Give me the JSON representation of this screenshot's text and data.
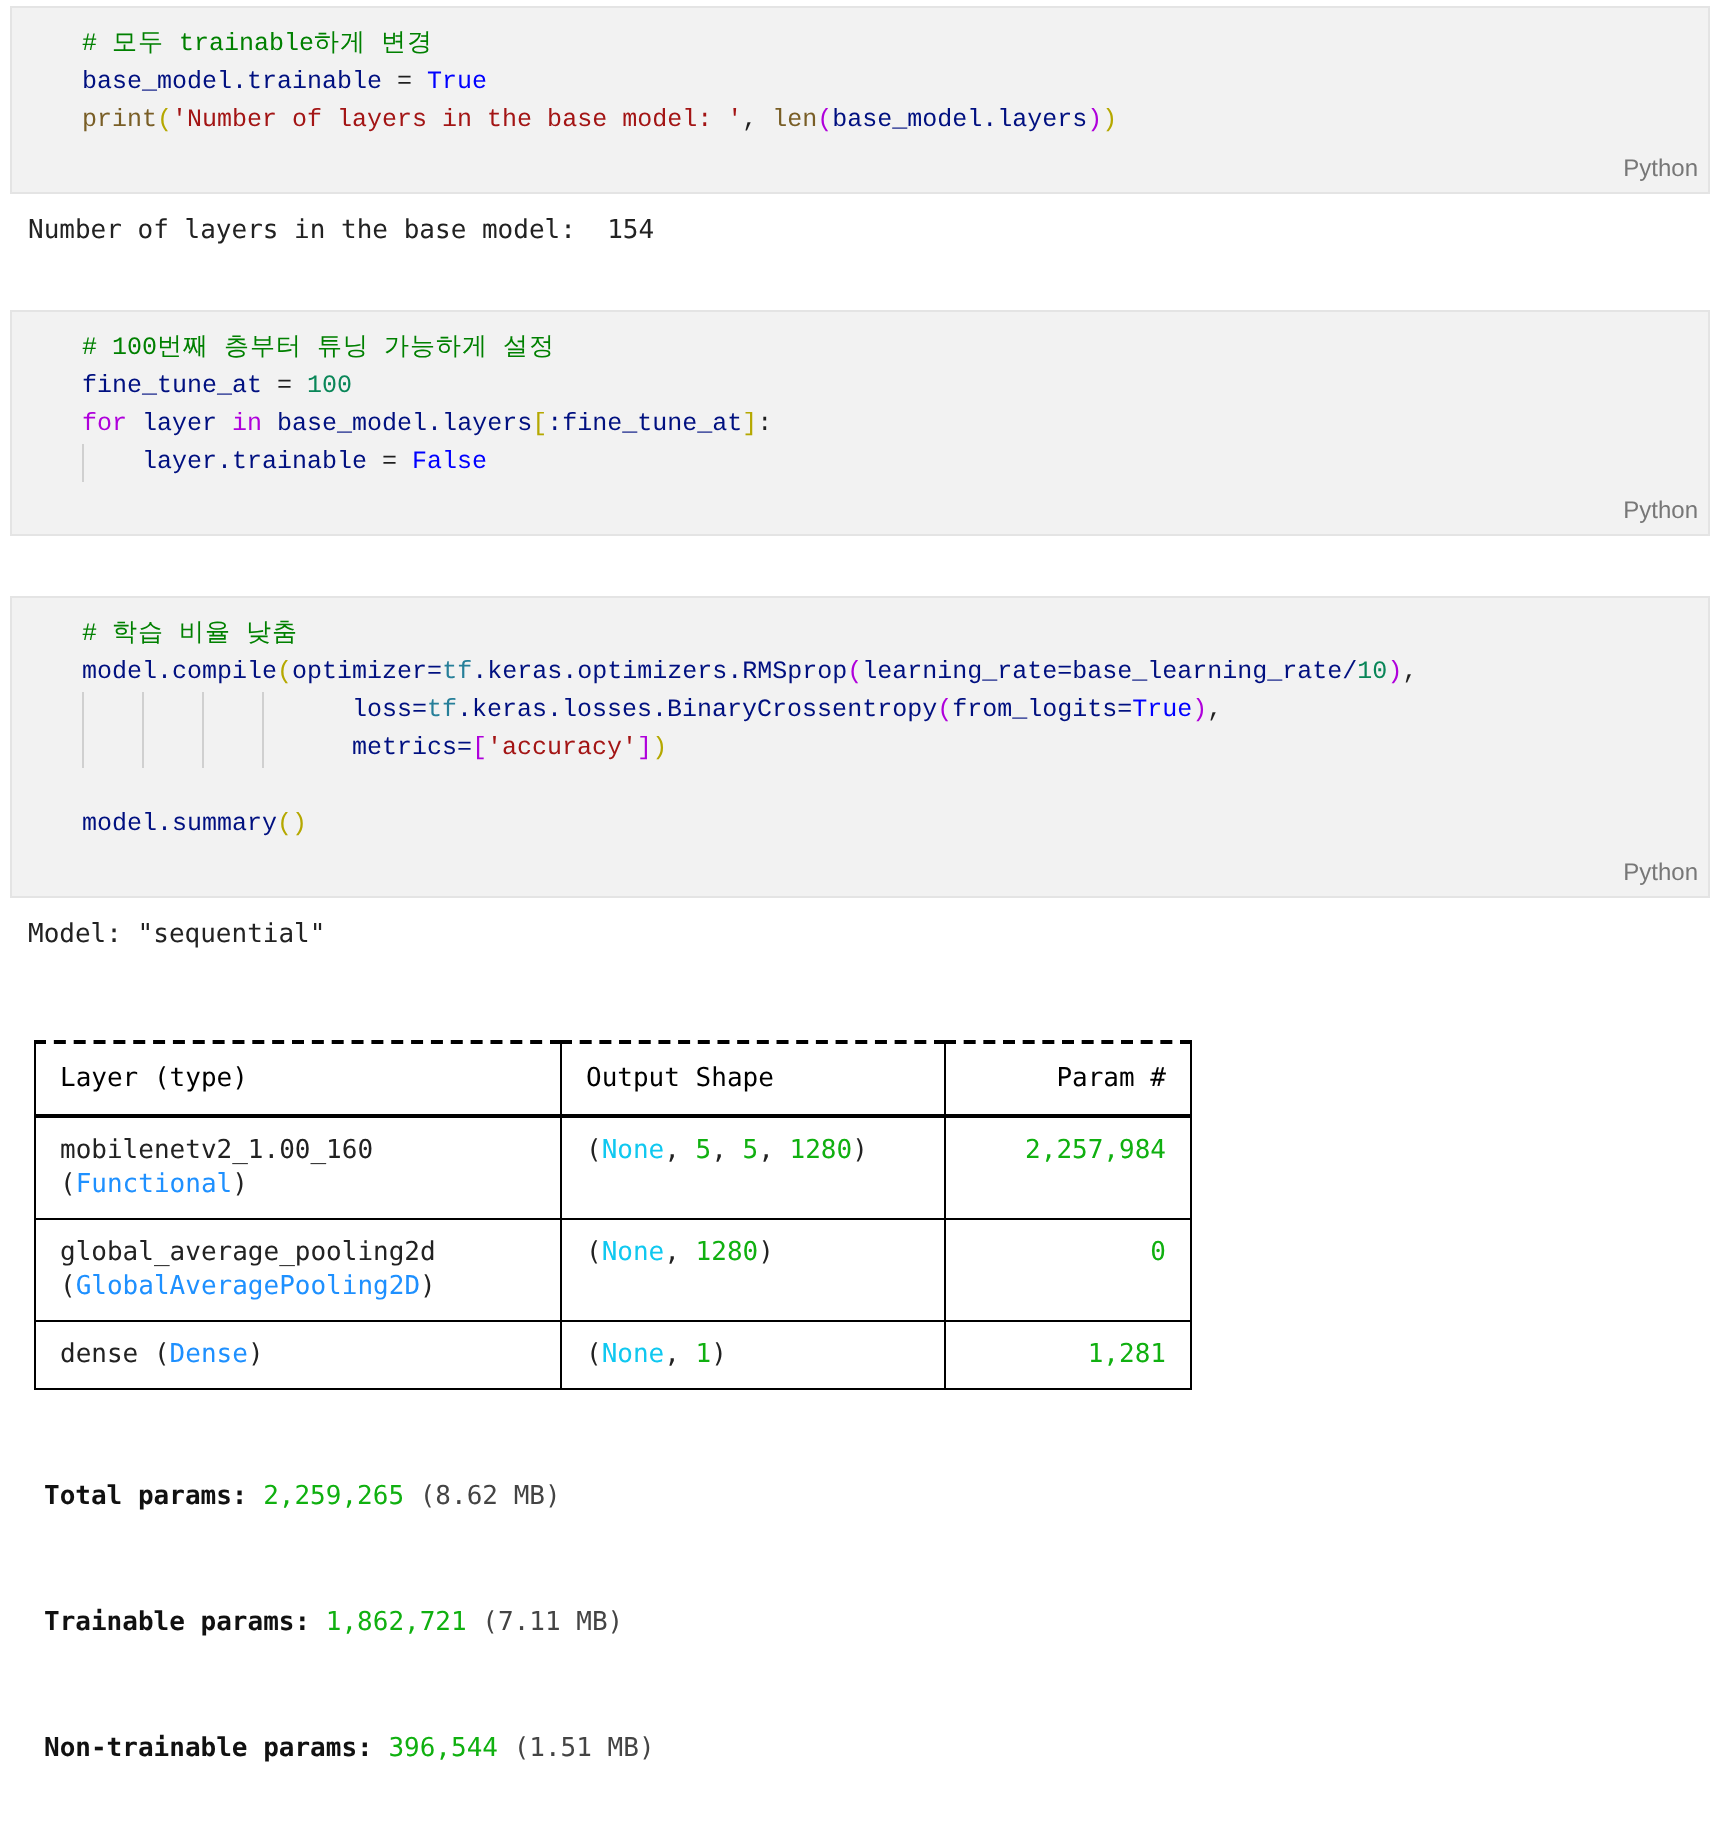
{
  "cells": [
    {
      "language": "Python",
      "lines": [
        {
          "kind": "plain",
          "tokens": [
            {
              "kind": "comment",
              "text": "# 모두 trainable하게 변경"
            }
          ]
        },
        {
          "kind": "plain",
          "tokens": [
            {
              "kind": "var",
              "text": "base_model.trainable"
            },
            {
              "kind": "plain",
              "text": " = "
            },
            {
              "kind": "const",
              "text": "True"
            }
          ]
        },
        {
          "kind": "plain",
          "tokens": [
            {
              "kind": "func",
              "text": "print"
            },
            {
              "kind": "bracket1",
              "text": "("
            },
            {
              "kind": "string",
              "text": "'Number of layers in the base model: '"
            },
            {
              "kind": "plain",
              "text": ", "
            },
            {
              "kind": "func",
              "text": "len"
            },
            {
              "kind": "bracket2",
              "text": "("
            },
            {
              "kind": "var",
              "text": "base_model.layers"
            },
            {
              "kind": "bracket2",
              "text": ")"
            },
            {
              "kind": "bracket1",
              "text": ")"
            }
          ]
        }
      ],
      "output": [
        {
          "kind": "text",
          "lines": [
            [
              {
                "kind": "plain",
                "text": "Number of layers in the base model:  154"
              }
            ]
          ]
        }
      ]
    },
    {
      "language": "Python",
      "lines": [
        {
          "kind": "plain",
          "tokens": [
            {
              "kind": "comment",
              "text": "# 100번째 층부터 튜닝 가능하게 설정"
            }
          ]
        },
        {
          "kind": "plain",
          "tokens": [
            {
              "kind": "var",
              "text": "fine_tune_at"
            },
            {
              "kind": "plain",
              "text": " = "
            },
            {
              "kind": "number",
              "text": "100"
            }
          ]
        },
        {
          "kind": "plain",
          "tokens": [
            {
              "kind": "keyword",
              "text": "for"
            },
            {
              "kind": "var",
              "text": " layer "
            },
            {
              "kind": "keyword",
              "text": "in"
            },
            {
              "kind": "var",
              "text": " base_model.layers"
            },
            {
              "kind": "bracket1",
              "text": "["
            },
            {
              "kind": "var",
              "text": ":fine_tune_at"
            },
            {
              "kind": "bracket1",
              "text": "]"
            },
            {
              "kind": "plain",
              "text": ":"
            }
          ]
        },
        {
          "kind": "body",
          "tokens": [
            {
              "kind": "var",
              "text": "layer.trainable"
            },
            {
              "kind": "plain",
              "text": " = "
            },
            {
              "kind": "const",
              "text": "False"
            }
          ]
        }
      ]
    },
    {
      "language": "Python",
      "lines": [
        {
          "kind": "plain",
          "tokens": [
            {
              "kind": "comment",
              "text": "# 학습 비율 낮춤"
            }
          ]
        },
        {
          "kind": "plain",
          "tokens": [
            {
              "kind": "var",
              "text": "model.compile"
            },
            {
              "kind": "bracket1",
              "text": "("
            },
            {
              "kind": "var",
              "text": "optimizer="
            },
            {
              "kind": "module",
              "text": "tf"
            },
            {
              "kind": "var",
              "text": ".keras.optimizers.RMSprop"
            },
            {
              "kind": "bracket2",
              "text": "("
            },
            {
              "kind": "var",
              "text": "learning_rate=base_learning_rate/"
            },
            {
              "kind": "number",
              "text": "10"
            },
            {
              "kind": "bracket2",
              "text": ")"
            },
            {
              "kind": "plain",
              "text": ","
            }
          ]
        },
        {
          "kind": "continuation",
          "tokens": [
            {
              "kind": "var",
              "text": "loss="
            },
            {
              "kind": "module",
              "text": "tf"
            },
            {
              "kind": "var",
              "text": ".keras.losses.BinaryCrossentropy"
            },
            {
              "kind": "bracket2",
              "text": "("
            },
            {
              "kind": "var",
              "text": "from_logits="
            },
            {
              "kind": "const",
              "text": "True"
            },
            {
              "kind": "bracket2",
              "text": ")"
            },
            {
              "kind": "plain",
              "text": ","
            }
          ]
        },
        {
          "kind": "continuation",
          "tokens": [
            {
              "kind": "var",
              "text": "metrics="
            },
            {
              "kind": "bracket2",
              "text": "["
            },
            {
              "kind": "string",
              "text": "'accuracy'"
            },
            {
              "kind": "bracket2",
              "text": "]"
            },
            {
              "kind": "bracket1",
              "text": ")"
            }
          ]
        },
        {
          "kind": "blank"
        },
        {
          "kind": "plain",
          "tokens": [
            {
              "kind": "var",
              "text": "model.summary"
            },
            {
              "kind": "bracket1",
              "text": "()"
            }
          ]
        }
      ],
      "output": [
        {
          "kind": "text",
          "lines": [
            [
              {
                "kind": "plain",
                "text": "Model: \"sequential\""
              }
            ]
          ]
        },
        {
          "kind": "table",
          "columns": [
            "Layer (type)",
            "Output Shape",
            "Param #"
          ],
          "rows": [
            [
              [
                [
                  {
                    "kind": "plain",
                    "text": "mobilenetv2_1.00_160"
                  }
                ],
                [
                  {
                    "kind": "plain",
                    "text": "("
                  },
                  {
                    "kind": "blue",
                    "text": "Functional"
                  },
                  {
                    "kind": "plain",
                    "text": ")"
                  }
                ]
              ],
              [
                [
                  {
                    "kind": "plain",
                    "text": "("
                  },
                  {
                    "kind": "cyan",
                    "text": "None"
                  },
                  {
                    "kind": "plain",
                    "text": ", "
                  },
                  {
                    "kind": "green",
                    "text": "5"
                  },
                  {
                    "kind": "plain",
                    "text": ", "
                  },
                  {
                    "kind": "green",
                    "text": "5"
                  },
                  {
                    "kind": "plain",
                    "text": ", "
                  },
                  {
                    "kind": "green",
                    "text": "1280"
                  },
                  {
                    "kind": "plain",
                    "text": ")"
                  }
                ]
              ],
              [
                [
                  {
                    "kind": "green",
                    "text": "2,257,984"
                  }
                ]
              ]
            ],
            [
              [
                [
                  {
                    "kind": "plain",
                    "text": "global_average_pooling2d"
                  }
                ],
                [
                  {
                    "kind": "plain",
                    "text": "("
                  },
                  {
                    "kind": "blue",
                    "text": "GlobalAveragePooling2D"
                  },
                  {
                    "kind": "plain",
                    "text": ")"
                  }
                ]
              ],
              [
                [
                  {
                    "kind": "plain",
                    "text": "("
                  },
                  {
                    "kind": "cyan",
                    "text": "None"
                  },
                  {
                    "kind": "plain",
                    "text": ", "
                  },
                  {
                    "kind": "green",
                    "text": "1280"
                  },
                  {
                    "kind": "plain",
                    "text": ")"
                  }
                ]
              ],
              [
                [
                  {
                    "kind": "green",
                    "text": "0"
                  }
                ]
              ]
            ],
            [
              [
                [
                  {
                    "kind": "plain",
                    "text": "dense ("
                  },
                  {
                    "kind": "blue",
                    "text": "Dense"
                  },
                  {
                    "kind": "plain",
                    "text": ")"
                  }
                ]
              ],
              [
                [
                  {
                    "kind": "plain",
                    "text": "("
                  },
                  {
                    "kind": "cyan",
                    "text": "None"
                  },
                  {
                    "kind": "plain",
                    "text": ", "
                  },
                  {
                    "kind": "green",
                    "text": "1"
                  },
                  {
                    "kind": "plain",
                    "text": ")"
                  }
                ]
              ],
              [
                [
                  {
                    "kind": "green",
                    "text": "1,281"
                  }
                ]
              ]
            ]
          ]
        },
        {
          "kind": "param",
          "lines": [
            [
              {
                "kind": "bold",
                "text": "Total params:"
              },
              {
                "kind": "green",
                "text": " 2,259,265"
              },
              {
                "kind": "gray",
                "text": " (8.62 MB)"
              }
            ]
          ]
        },
        {
          "kind": "param",
          "lines": [
            [
              {
                "kind": "bold",
                "text": "Trainable params:"
              },
              {
                "kind": "green",
                "text": " 1,862,721"
              },
              {
                "kind": "gray",
                "text": " (7.11 MB)"
              }
            ]
          ]
        },
        {
          "kind": "param",
          "lines": [
            [
              {
                "kind": "bold",
                "text": "Non-trainable params:"
              },
              {
                "kind": "green",
                "text": " 396,544"
              },
              {
                "kind": "gray",
                "text": " (1.51 MB)"
              }
            ]
          ]
        }
      ]
    }
  ]
}
